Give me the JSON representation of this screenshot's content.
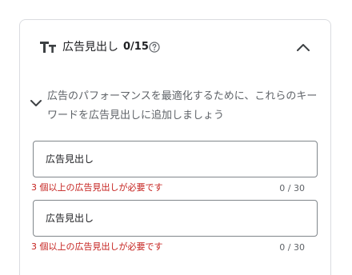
{
  "panel": {
    "title": "広告見出し",
    "count": "0/15",
    "icons": {
      "type": "text-format-icon",
      "help": "help-circle-icon",
      "collapse": "chevron-up-icon",
      "expand": "chevron-down-icon"
    }
  },
  "hint": {
    "text": "広告のパフォーマンスを最適化するために、これらのキーワードを広告見出しに追加しましょう"
  },
  "headlines": [
    {
      "placeholder": "広告見出し",
      "value": "",
      "error": "3 個以上の広告見出しが必要です",
      "counter": "0 / 30"
    },
    {
      "placeholder": "広告見出し",
      "value": "",
      "error": "3 個以上の広告見出しが必要です",
      "counter": "0 / 30"
    }
  ],
  "colors": {
    "error": "#c5221f",
    "border": "#80868b",
    "muted": "#5f6368"
  }
}
